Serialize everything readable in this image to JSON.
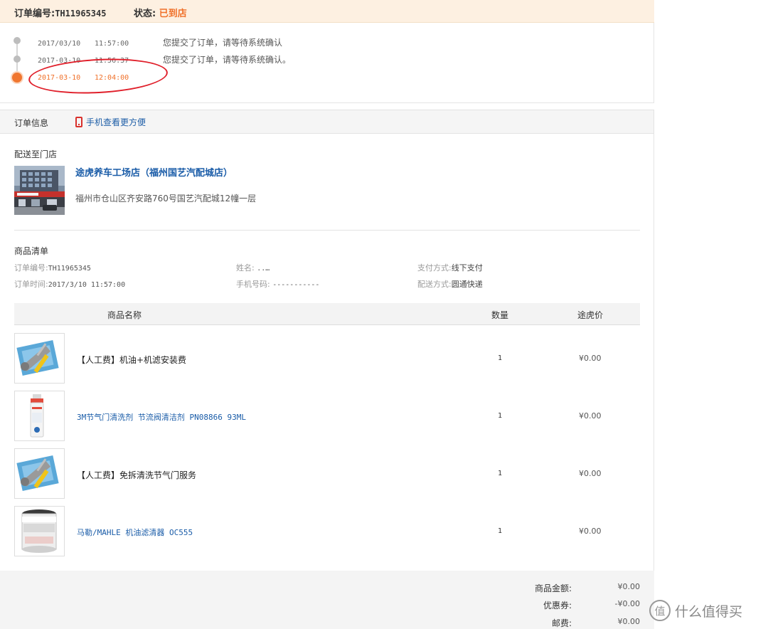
{
  "header": {
    "order_no_label": "订单编号:",
    "order_no": "TH11965345",
    "status_label": "状态:",
    "status": "已到店"
  },
  "timeline": [
    {
      "date": "2017/03/10",
      "time": "11:57:00",
      "message": "您提交了订单，请等待系统确认"
    },
    {
      "date": "2017-03-10",
      "time": "11:56:37",
      "message": "您提交了订单，请等待系统确认。"
    },
    {
      "date": "2017-03-10",
      "time": "12:04:00",
      "message": ""
    }
  ],
  "info_bar": {
    "tab_label": "订单信息",
    "mobile_link": "手机查看更方便"
  },
  "store": {
    "section_title": "配送至门店",
    "name": "途虎养车工场店（福州国艺汽配城店）",
    "address": "福州市仓山区齐安路760号国艺汽配城12幢一层"
  },
  "order_details": {
    "section_title": "商品清单",
    "order_no_label": "订单编号:",
    "order_no": "TH11965345",
    "order_time_label": "订单时间:",
    "order_time": "2017/3/10 11:57:00",
    "name_label": "姓名:",
    "name": "..…",
    "phone_label": "手机号码:",
    "phone": "-----------",
    "payment_label": "支付方式:",
    "payment": "线下支付",
    "delivery_label": "配送方式:",
    "delivery": "圆通快递"
  },
  "table": {
    "columns": [
      "商品名称",
      "数量",
      "途虎价"
    ],
    "rows": [
      {
        "name": "【人工费】机油+机滤安装费",
        "qty": "1",
        "price": "¥0.00",
        "icon": "tools-icon"
      },
      {
        "name": "3M节气门清洗剂 节流阀清洁剂 PN08866 93ML",
        "qty": "1",
        "price": "¥0.00",
        "icon": "spray-can-icon"
      },
      {
        "name": "【人工费】免拆清洗节气门服务",
        "qty": "1",
        "price": "¥0.00",
        "icon": "tools-icon"
      },
      {
        "name": "马勒/MAHLE 机油滤清器 OC555",
        "qty": "1",
        "price": "¥0.00",
        "icon": "oil-filter-icon"
      }
    ]
  },
  "totals": [
    {
      "label": "商品金额:",
      "value": "¥0.00"
    },
    {
      "label": "优惠券:",
      "value": "-¥0.00"
    },
    {
      "label": "邮费:",
      "value": "¥0.00"
    }
  ],
  "watermark": {
    "text": "什么值得买",
    "icon_glyph": "值"
  },
  "colors": {
    "accent": "#f0712a",
    "link": "#1a5ca8",
    "annotation": "#e01f2a"
  }
}
